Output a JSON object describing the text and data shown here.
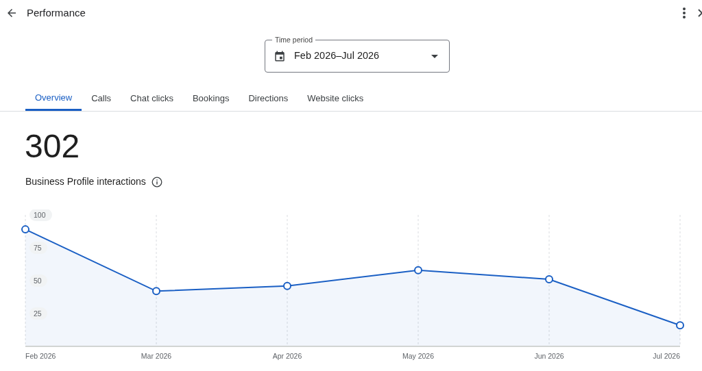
{
  "header": {
    "title": "Performance"
  },
  "time_period": {
    "label": "Time period",
    "value": "Feb 2026–Jul 2026"
  },
  "tabs": [
    {
      "label": "Overview",
      "selected": true
    },
    {
      "label": "Calls",
      "selected": false
    },
    {
      "label": "Chat clicks",
      "selected": false
    },
    {
      "label": "Bookings",
      "selected": false
    },
    {
      "label": "Directions",
      "selected": false
    },
    {
      "label": "Website clicks",
      "selected": false
    }
  ],
  "summary": {
    "value": "302",
    "label": "Business Profile interactions"
  },
  "chart_data": {
    "type": "area",
    "categories": [
      "Feb 2026",
      "Mar 2026",
      "Apr 2026",
      "May 2026",
      "Jun 2026",
      "Jul 2026"
    ],
    "grid": true,
    "series": [
      {
        "color": "#1a5fc4",
        "values": [
          89,
          42,
          46,
          58,
          51,
          16
        ]
      }
    ],
    "ylim": [
      0,
      100
    ],
    "yticks": [
      25,
      50,
      75,
      100
    ]
  }
}
